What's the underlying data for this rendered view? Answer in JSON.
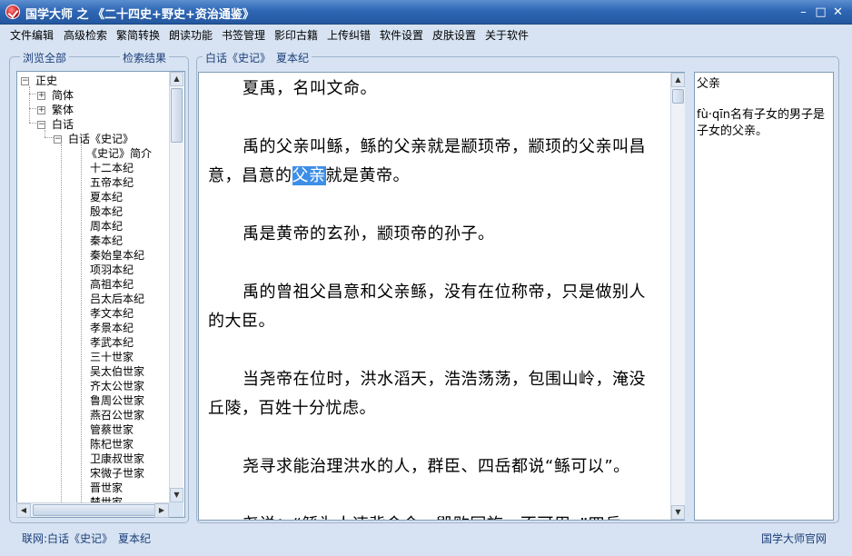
{
  "window": {
    "title": "国学大师 之 《二十四史+野史+资治通鉴》",
    "min_glyph": "–",
    "max_glyph": "□",
    "close_glyph": "✕"
  },
  "menu": [
    "文件编辑",
    "高级检索",
    "繁简转换",
    "朗读功能",
    "书签管理",
    "影印古籍",
    "上传纠错",
    "软件设置",
    "皮肤设置",
    "关于软件"
  ],
  "left_panel": {
    "tab_browse": "浏览全部",
    "tab_search": "检索结果"
  },
  "tree": {
    "root": "正史",
    "simplified": "简体",
    "traditional": "繁体",
    "vernacular": "白话",
    "shiji": "白话《史记》",
    "chapters": [
      "《史记》简介",
      "十二本纪",
      "五帝本纪",
      "夏本纪",
      "殷本纪",
      "周本纪",
      "秦本纪",
      "秦始皇本纪",
      "项羽本纪",
      "高祖本纪",
      "吕太后本纪",
      "孝文本纪",
      "孝景本纪",
      "孝武本纪",
      "三十世家",
      "吴太伯世家",
      "齐太公世家",
      "鲁周公世家",
      "燕召公世家",
      "管蔡世家",
      "陈杞世家",
      "卫康叔世家",
      "宋微子世家",
      "晋世家",
      "楚世家"
    ]
  },
  "reader": {
    "header": "白话《史记》　夏本纪",
    "p1": "夏禹，名叫文命。",
    "p2_before": "禹的父亲叫鲧，鲧的父亲就是颛顼帝，颛顼的父亲叫昌意，昌意的",
    "p2_highlight": "父亲",
    "p2_after": "就是黄帝。",
    "p3": "禹是黄帝的玄孙，颛顼帝的孙子。",
    "p4": "禹的曾祖父昌意和父亲鲧，没有在位称帝，只是做别人的大臣。",
    "p5": "当尧帝在位时，洪水滔天，浩浩荡荡，包围山岭，淹没丘陵，百姓十分忧虑。",
    "p6": "尧寻求能治理洪水的人，群臣、四岳都说“鲧可以”。",
    "p7": "尧说：“鲧为人违背命令，毁败同族，不可用。”四岳"
  },
  "dictionary": {
    "word": "父亲",
    "definition": "fù·qīn名有子女的男子是子女的父亲。"
  },
  "status": {
    "location": "联网:白话《史记》　夏本纪",
    "website": "国学大师官网"
  },
  "colors": {
    "title_bar": "#2f67b6",
    "highlight": "#3d8ee8",
    "background": "#d7e3f2"
  }
}
